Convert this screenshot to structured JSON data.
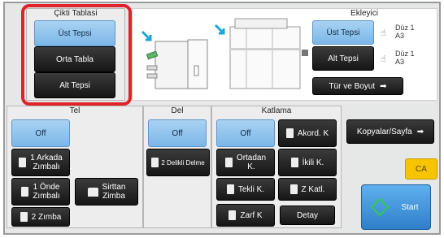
{
  "output_tray": {
    "title": "Çikti Tablasi",
    "buttons": [
      "Üst Tepsi",
      "Orta Tabla",
      "Alt Tepsi"
    ]
  },
  "inserter": {
    "title": "Ekleyici",
    "buttons": [
      "Üst Tepsi",
      "Alt Tepsi"
    ],
    "upper_side": "Düz 1",
    "upper_size": "A3",
    "lower_side": "Düz 1",
    "lower_size": "A3",
    "type_size_button": "Tür ve Boyut"
  },
  "staple": {
    "title": "Tel",
    "off": "Off",
    "back_1": "1 Arkada\nZımbalı",
    "front_1": "1 Önde\nZımbalı",
    "saddle": "Sirttan\nZimba",
    "two": "2 Zımba"
  },
  "punch": {
    "title": "Del",
    "off": "Off",
    "two_hole": "2 Delikli Delme"
  },
  "fold": {
    "title": "Katlama",
    "off": "Off",
    "accordion": "Akord. K",
    "center": "Ortadan\nK.",
    "double": "İkili K.",
    "single": "Tekli K.",
    "z": "Z Katl.",
    "envelope": "Zarf K",
    "detail": "Detay"
  },
  "side": {
    "copies_per_set": "Kopyalar/Sayfa",
    "ca": "CA",
    "start": "Start"
  },
  "colors": {
    "highlight_red": "#e0232a",
    "selected_blue": "#8ec4ee",
    "ca_yellow": "#f6c400"
  }
}
